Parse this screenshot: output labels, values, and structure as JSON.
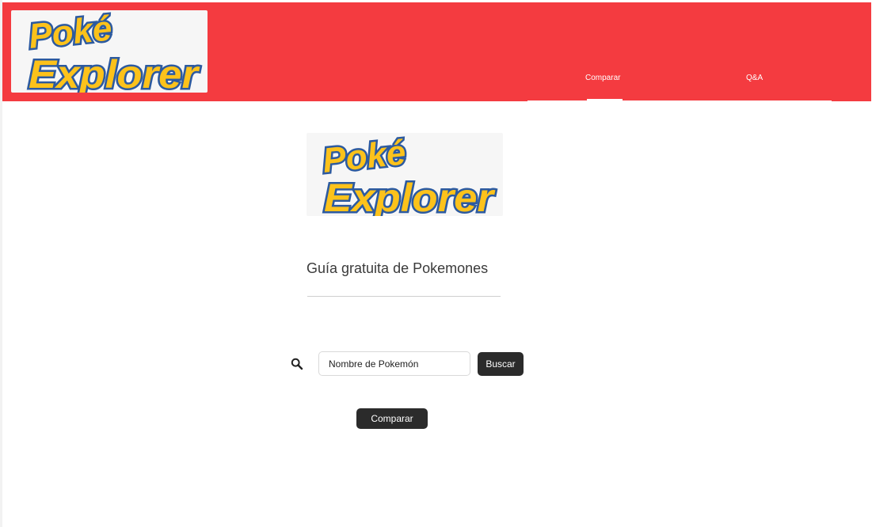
{
  "header": {
    "logo": {
      "line1": "Poké",
      "line2": "Explorer"
    },
    "nav": {
      "tabs": [
        {
          "label": "Comparar",
          "active": true
        },
        {
          "label": "Q&A",
          "active": false
        }
      ]
    }
  },
  "main": {
    "logo": {
      "line1": "Poké",
      "line2": "Explorer"
    },
    "subtitle": "Guía gratuita de Pokemones",
    "search": {
      "icon": "search-icon",
      "value": "",
      "placeholder": "Nombre de Pokemón",
      "button_label": "Buscar"
    },
    "compare_button_label": "Comparar"
  },
  "colors": {
    "header_bg": "#f43b40",
    "logo_yellow": "#fcc21b",
    "logo_outline": "#2c5aa0",
    "button_dark": "#2b2b2b"
  }
}
